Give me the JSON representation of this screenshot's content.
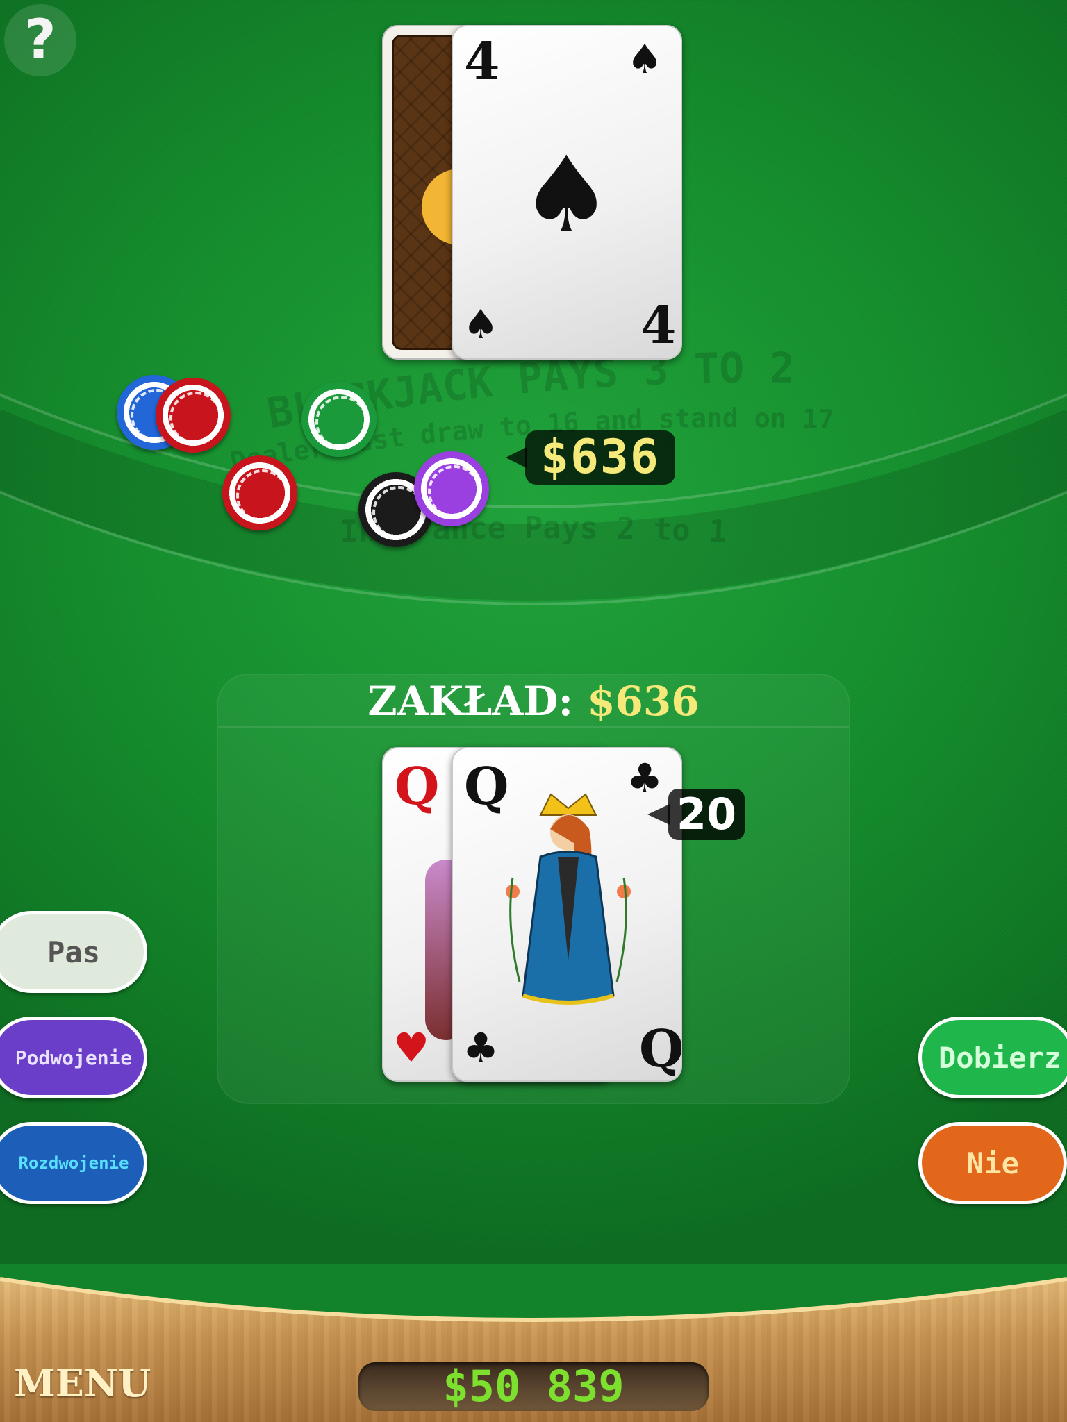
{
  "help_button": {
    "label": "?"
  },
  "table_print": {
    "line1": "BLACKJACK PAYS 3 TO 2",
    "line2": "Dealer must draw to 16 and stand on 17",
    "line3": "Insurance Pays 2 to 1"
  },
  "dealer": {
    "hidden_card": {
      "face_down": true
    },
    "up_card": {
      "rank": "4",
      "suit": "spades",
      "suit_symbol": "♠"
    },
    "bet_bubble": "$636"
  },
  "chips": [
    {
      "color": "#2266d8",
      "ring": "#ffffff"
    },
    {
      "color": "#c8141c",
      "ring": "#ffffff"
    },
    {
      "color": "#1a9a3a",
      "ring": "#ffffff"
    },
    {
      "color": "#c8141c",
      "ring": "#ffffff"
    },
    {
      "color": "#1b1b1b",
      "ring": "#ffffff"
    },
    {
      "color": "#9a3fe0",
      "ring": "#ffffff"
    }
  ],
  "bet_panel": {
    "label": "ZAKŁAD:",
    "amount": "$636"
  },
  "player": {
    "cards": [
      {
        "rank": "Q",
        "suit": "hearts",
        "suit_symbol": "♥",
        "color": "red"
      },
      {
        "rank": "Q",
        "suit": "clubs",
        "suit_symbol": "♣",
        "color": "black"
      }
    ],
    "score": "20"
  },
  "actions_left": [
    {
      "label": "Pas",
      "bg": "#dfe9dc",
      "fg": "#555555"
    },
    {
      "label": "Podwojenie",
      "bg": "#6a3ec9",
      "fg": "#e9e2ff"
    },
    {
      "label": "Rozdwojenie",
      "bg": "#1d5fb8",
      "fg": "#59e0ff"
    }
  ],
  "actions_right": [
    {
      "label": "Dobierz",
      "bg": "#1fb64b",
      "fg": "#d4ffd8"
    },
    {
      "label": "Nie",
      "bg": "#e2671a",
      "fg": "#ffe5a3"
    }
  ],
  "bottom_bar": {
    "menu_label": "MENU",
    "balance": "$50 839"
  }
}
